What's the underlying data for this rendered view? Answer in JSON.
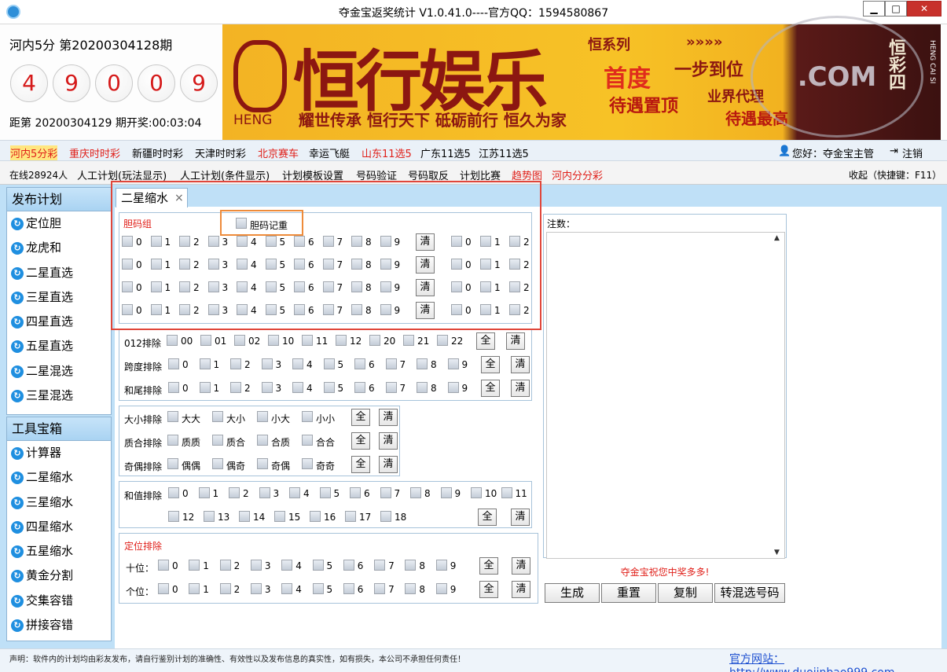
{
  "window": {
    "title": "夺金宝返奖统计  V1.0.41.0----官方QQ：1594580867",
    "minimize": "▁",
    "maximize": "□",
    "close": "✕"
  },
  "draw": {
    "lottery_name": "河内5分  第20200304128期",
    "balls": [
      "4",
      "9",
      "0",
      "0",
      "9"
    ],
    "countdown": "距第 20200304129 期开奖:00:03:04"
  },
  "ad": {
    "brand": "恒行娱乐",
    "slogan": "耀世传承 恒行天下 砥砺前行 恒久为家",
    "heng": "HENG",
    "r1": "恒系列",
    "r2": "首度",
    "r3": "待遇置顶",
    "r4": "»»»»",
    "r5": "一步到位",
    "r6": "业界代理",
    "r7": "待遇最高",
    "r8": "恒彩四",
    "r9": "HENG CAI SI"
  },
  "lottery_bar": {
    "items": [
      "河内5分彩",
      "重庆时时彩",
      "新疆时时彩",
      "天津时时彩",
      "北京赛车",
      "幸运飞艇",
      "山东11选5",
      "广东11选5",
      "江苏11选5"
    ],
    "greeting": "您好：夺金宝主管",
    "logout": "注销"
  },
  "menu_bar": {
    "online": "在线28924人",
    "items": [
      "人工计划(玩法显示)",
      "人工计划(条件显示)",
      "计划模板设置",
      "号码验证",
      "号码取反",
      "计划比赛",
      "趋势图",
      "河内分分彩"
    ],
    "collapse": "收起（快捷键：F11）"
  },
  "sidebar": {
    "publish_title": "发布计划",
    "publish_items": [
      "定位胆",
      "龙虎和",
      "二星直选",
      "三星直选",
      "四星直选",
      "五星直选",
      "二星混选",
      "三星混选"
    ],
    "tools_title": "工具宝箱",
    "tools_items": [
      "计算器",
      "二星缩水",
      "三星缩水",
      "四星缩水",
      "五星缩水",
      "黄金分割",
      "交集容错",
      "拼接容错"
    ]
  },
  "tab": {
    "label": "二星缩水",
    "close": "×"
  },
  "filters": {
    "dan_group_label": "胆码组",
    "dan_repeat_label": "胆码记重",
    "digits": [
      "0",
      "1",
      "2",
      "3",
      "4",
      "5",
      "6",
      "7",
      "8",
      "9"
    ],
    "clear": "清",
    "all": "全",
    "r012_label": "012排除",
    "r012_values": [
      "00",
      "01",
      "02",
      "10",
      "11",
      "12",
      "20",
      "21",
      "22"
    ],
    "span_label": "跨度排除",
    "hewei_label": "和尾排除",
    "size_label": "大小排除",
    "size_values": [
      "大大",
      "大小",
      "小大",
      "小小"
    ],
    "prime_label": "质合排除",
    "prime_values": [
      "质质",
      "质合",
      "合质",
      "合合"
    ],
    "parity_label": "奇偶排除",
    "parity_values": [
      "偶偶",
      "偶奇",
      "奇偶",
      "奇奇"
    ],
    "sum_label": "和值排除",
    "sum_values": [
      "0",
      "1",
      "2",
      "3",
      "4",
      "5",
      "6",
      "7",
      "8",
      "9",
      "10",
      "11",
      "12",
      "13",
      "14",
      "15",
      "16",
      "17",
      "18"
    ],
    "position_label": "定位排除",
    "tens_label": "十位：",
    "ones_label": "个位："
  },
  "notes": {
    "label": "注数：",
    "scroll_up": "▲",
    "scroll_down": "▼",
    "wish": "夺金宝祝您中奖多多!"
  },
  "actions": [
    "生成",
    "重置",
    "复制",
    "转混选号码"
  ],
  "status": {
    "disclaimer": "声明：软件内的计划均由彩友发布，请自行鉴别计划的准确性、有效性以及发布信息的真实性，如有损失，本公司不承担任何责任！",
    "website": "官方网站：http://www.duojinbao999.com"
  },
  "colors": {
    "accent_red": "#e0201a",
    "sidebar_blue": "#bfe0f7",
    "ad_gold": "#f7c226"
  }
}
